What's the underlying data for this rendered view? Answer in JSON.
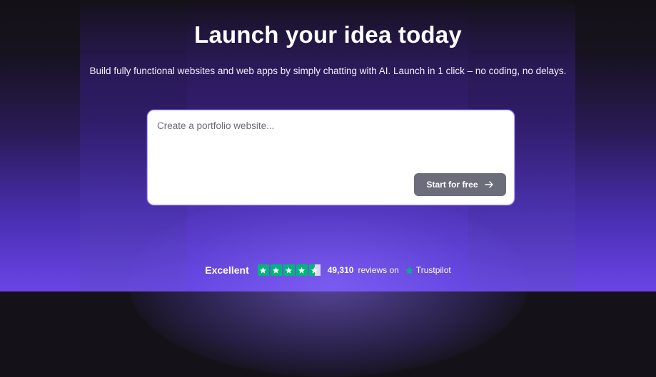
{
  "hero": {
    "title": "Launch your idea today",
    "subtitle": "Build fully functional websites and web apps by simply chatting with AI. Launch in 1 click – no coding, no delays."
  },
  "prompt": {
    "placeholder": "Create a portfolio website...",
    "value": "",
    "button_label": "Start for free",
    "button_icon": "arrow-right-icon"
  },
  "rating": {
    "label": "Excellent",
    "stars": 4.5,
    "reviews_count": "49,310",
    "reviews_suffix": "reviews on",
    "platform": "Trustpilot",
    "star_color": "#00b67a"
  },
  "colors": {
    "accent": "#6a45e6",
    "button": "#6b6d7a"
  }
}
